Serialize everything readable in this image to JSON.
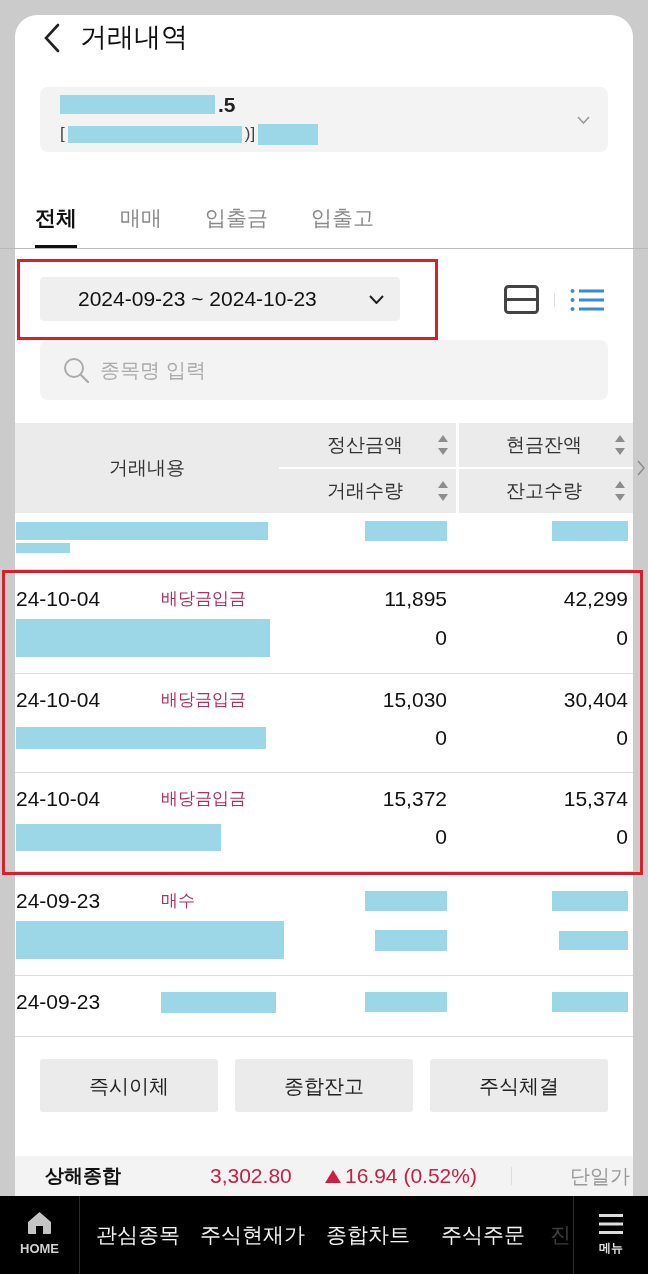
{
  "header": {
    "title": "거래내역"
  },
  "account": {
    "lines": [
      [
        {
          "kind": "redacted"
        },
        {
          "kind": "text",
          "text": ".5"
        }
      ],
      [
        {
          "kind": "text",
          "text": "["
        },
        {
          "kind": "redacted"
        },
        {
          "kind": "text",
          "text": ")]"
        },
        {
          "kind": "redacted"
        }
      ]
    ]
  },
  "tabs": [
    {
      "label": "전체",
      "selected": true
    },
    {
      "label": "매매",
      "selected": false
    },
    {
      "label": "입출금",
      "selected": false
    },
    {
      "label": "입출고",
      "selected": false
    }
  ],
  "date_filter": {
    "value": "2024-09-23 ~ 2024-10-23",
    "highlighted": true
  },
  "view_modes": [
    {
      "kind": "split",
      "selected": false
    },
    {
      "kind": "list",
      "selected": true
    }
  ],
  "search": {
    "placeholder": "종목명 입력"
  },
  "table": {
    "columns": [
      {
        "labels": [
          "거래내용"
        ],
        "sortable": false
      },
      {
        "labels": [
          "정산금액",
          "거래수량"
        ],
        "sortable": true
      },
      {
        "labels": [
          "현금잔액",
          "잔고수량"
        ],
        "sortable": true
      }
    ],
    "rows": [
      {
        "highlighted": false,
        "detail": [
          {
            "kind": "redacted"
          }
        ],
        "name": {
          "kind": "redacted"
        },
        "amount": {
          "kind": "redacted"
        },
        "cash_balance": {
          "kind": "redacted"
        }
      },
      {
        "highlighted": true,
        "detail": [
          {
            "kind": "date",
            "text": "24-10-04"
          },
          {
            "kind": "type",
            "text": "배당금입금"
          }
        ],
        "name": {
          "kind": "redacted"
        },
        "amount": {
          "kind": "text",
          "text": "11,895"
        },
        "quantity": {
          "kind": "text",
          "text": "0"
        },
        "cash_balance": {
          "kind": "text",
          "text": "42,299"
        },
        "stock_balance": {
          "kind": "text",
          "text": "0"
        }
      },
      {
        "highlighted": true,
        "detail": [
          {
            "kind": "date",
            "text": "24-10-04"
          },
          {
            "kind": "type",
            "text": "배당금입금"
          }
        ],
        "name": {
          "kind": "redacted"
        },
        "amount": {
          "kind": "text",
          "text": "15,030"
        },
        "quantity": {
          "kind": "text",
          "text": "0"
        },
        "cash_balance": {
          "kind": "text",
          "text": "30,404"
        },
        "stock_balance": {
          "kind": "text",
          "text": "0"
        }
      },
      {
        "highlighted": true,
        "detail": [
          {
            "kind": "date",
            "text": "24-10-04"
          },
          {
            "kind": "type",
            "text": "배당금입금"
          }
        ],
        "name": {
          "kind": "redacted"
        },
        "amount": {
          "kind": "text",
          "text": "15,372"
        },
        "quantity": {
          "kind": "text",
          "text": "0"
        },
        "cash_balance": {
          "kind": "text",
          "text": "15,374"
        },
        "stock_balance": {
          "kind": "text",
          "text": "0"
        }
      },
      {
        "highlighted": false,
        "detail": [
          {
            "kind": "date",
            "text": "24-09-23"
          },
          {
            "kind": "type",
            "text": "매수"
          }
        ],
        "name": {
          "kind": "redacted"
        },
        "amount": {
          "kind": "redacted"
        },
        "quantity": {
          "kind": "redacted"
        },
        "cash_balance": {
          "kind": "redacted"
        },
        "stock_balance": {
          "kind": "redacted"
        }
      },
      {
        "highlighted": false,
        "detail": [
          {
            "kind": "date",
            "text": "24-09-23"
          },
          {
            "kind": "redacted"
          }
        ],
        "amount": {
          "kind": "redacted"
        },
        "cash_balance": {
          "kind": "redacted"
        }
      }
    ]
  },
  "actions": [
    {
      "label": "즉시이체"
    },
    {
      "label": "종합잔고"
    },
    {
      "label": "주식체결"
    }
  ],
  "index_ticker": {
    "name": "상해종합",
    "value": "3,302.80",
    "rising": true,
    "change": "16.94 (0.52%)",
    "session": "단일가"
  },
  "bottom_nav": {
    "home": {
      "label": "HOME"
    },
    "items": [
      {
        "label": "관심종목",
        "faded": false
      },
      {
        "label": "주식현재가",
        "faded": false
      },
      {
        "label": "종합차트",
        "faded": false
      },
      {
        "label": "주식주문",
        "faded": false
      },
      {
        "label": "진",
        "faded": true
      }
    ],
    "menu": {
      "label": "메뉴"
    }
  }
}
